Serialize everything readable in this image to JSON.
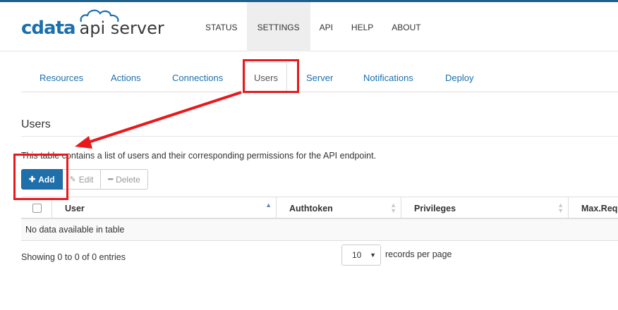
{
  "app": {
    "logo_brand": "cdata",
    "logo_product": "api server"
  },
  "nav": [
    "STATUS",
    "SETTINGS",
    "API",
    "HELP",
    "ABOUT"
  ],
  "nav_active": "SETTINGS",
  "tabs": [
    "Resources",
    "Actions",
    "Connections",
    "Users",
    "Server",
    "Notifications",
    "Deploy"
  ],
  "tab_active": "Users",
  "section": {
    "title": "Users",
    "description": "This table contains a list of users and their corresponding permissions for the API endpoint."
  },
  "buttons": {
    "add": "Add",
    "edit": "Edit",
    "delete": "Delete"
  },
  "table": {
    "columns": [
      "User",
      "Authtoken",
      "Privileges",
      "Max.Req"
    ],
    "empty_text": "No data available in table"
  },
  "footer": {
    "showing": "Showing 0 to 0 of 0 entries",
    "page_length": "10",
    "page_length_label": "records per page"
  },
  "icons": {
    "add": "plus-icon",
    "edit": "pencil-icon",
    "delete": "minus-icon",
    "sort": "sort-icon",
    "select": "caret-down-icon"
  },
  "colors": {
    "brand": "#1a6fae",
    "primary_button": "#1f6fab",
    "annotation": "#e8191c"
  }
}
